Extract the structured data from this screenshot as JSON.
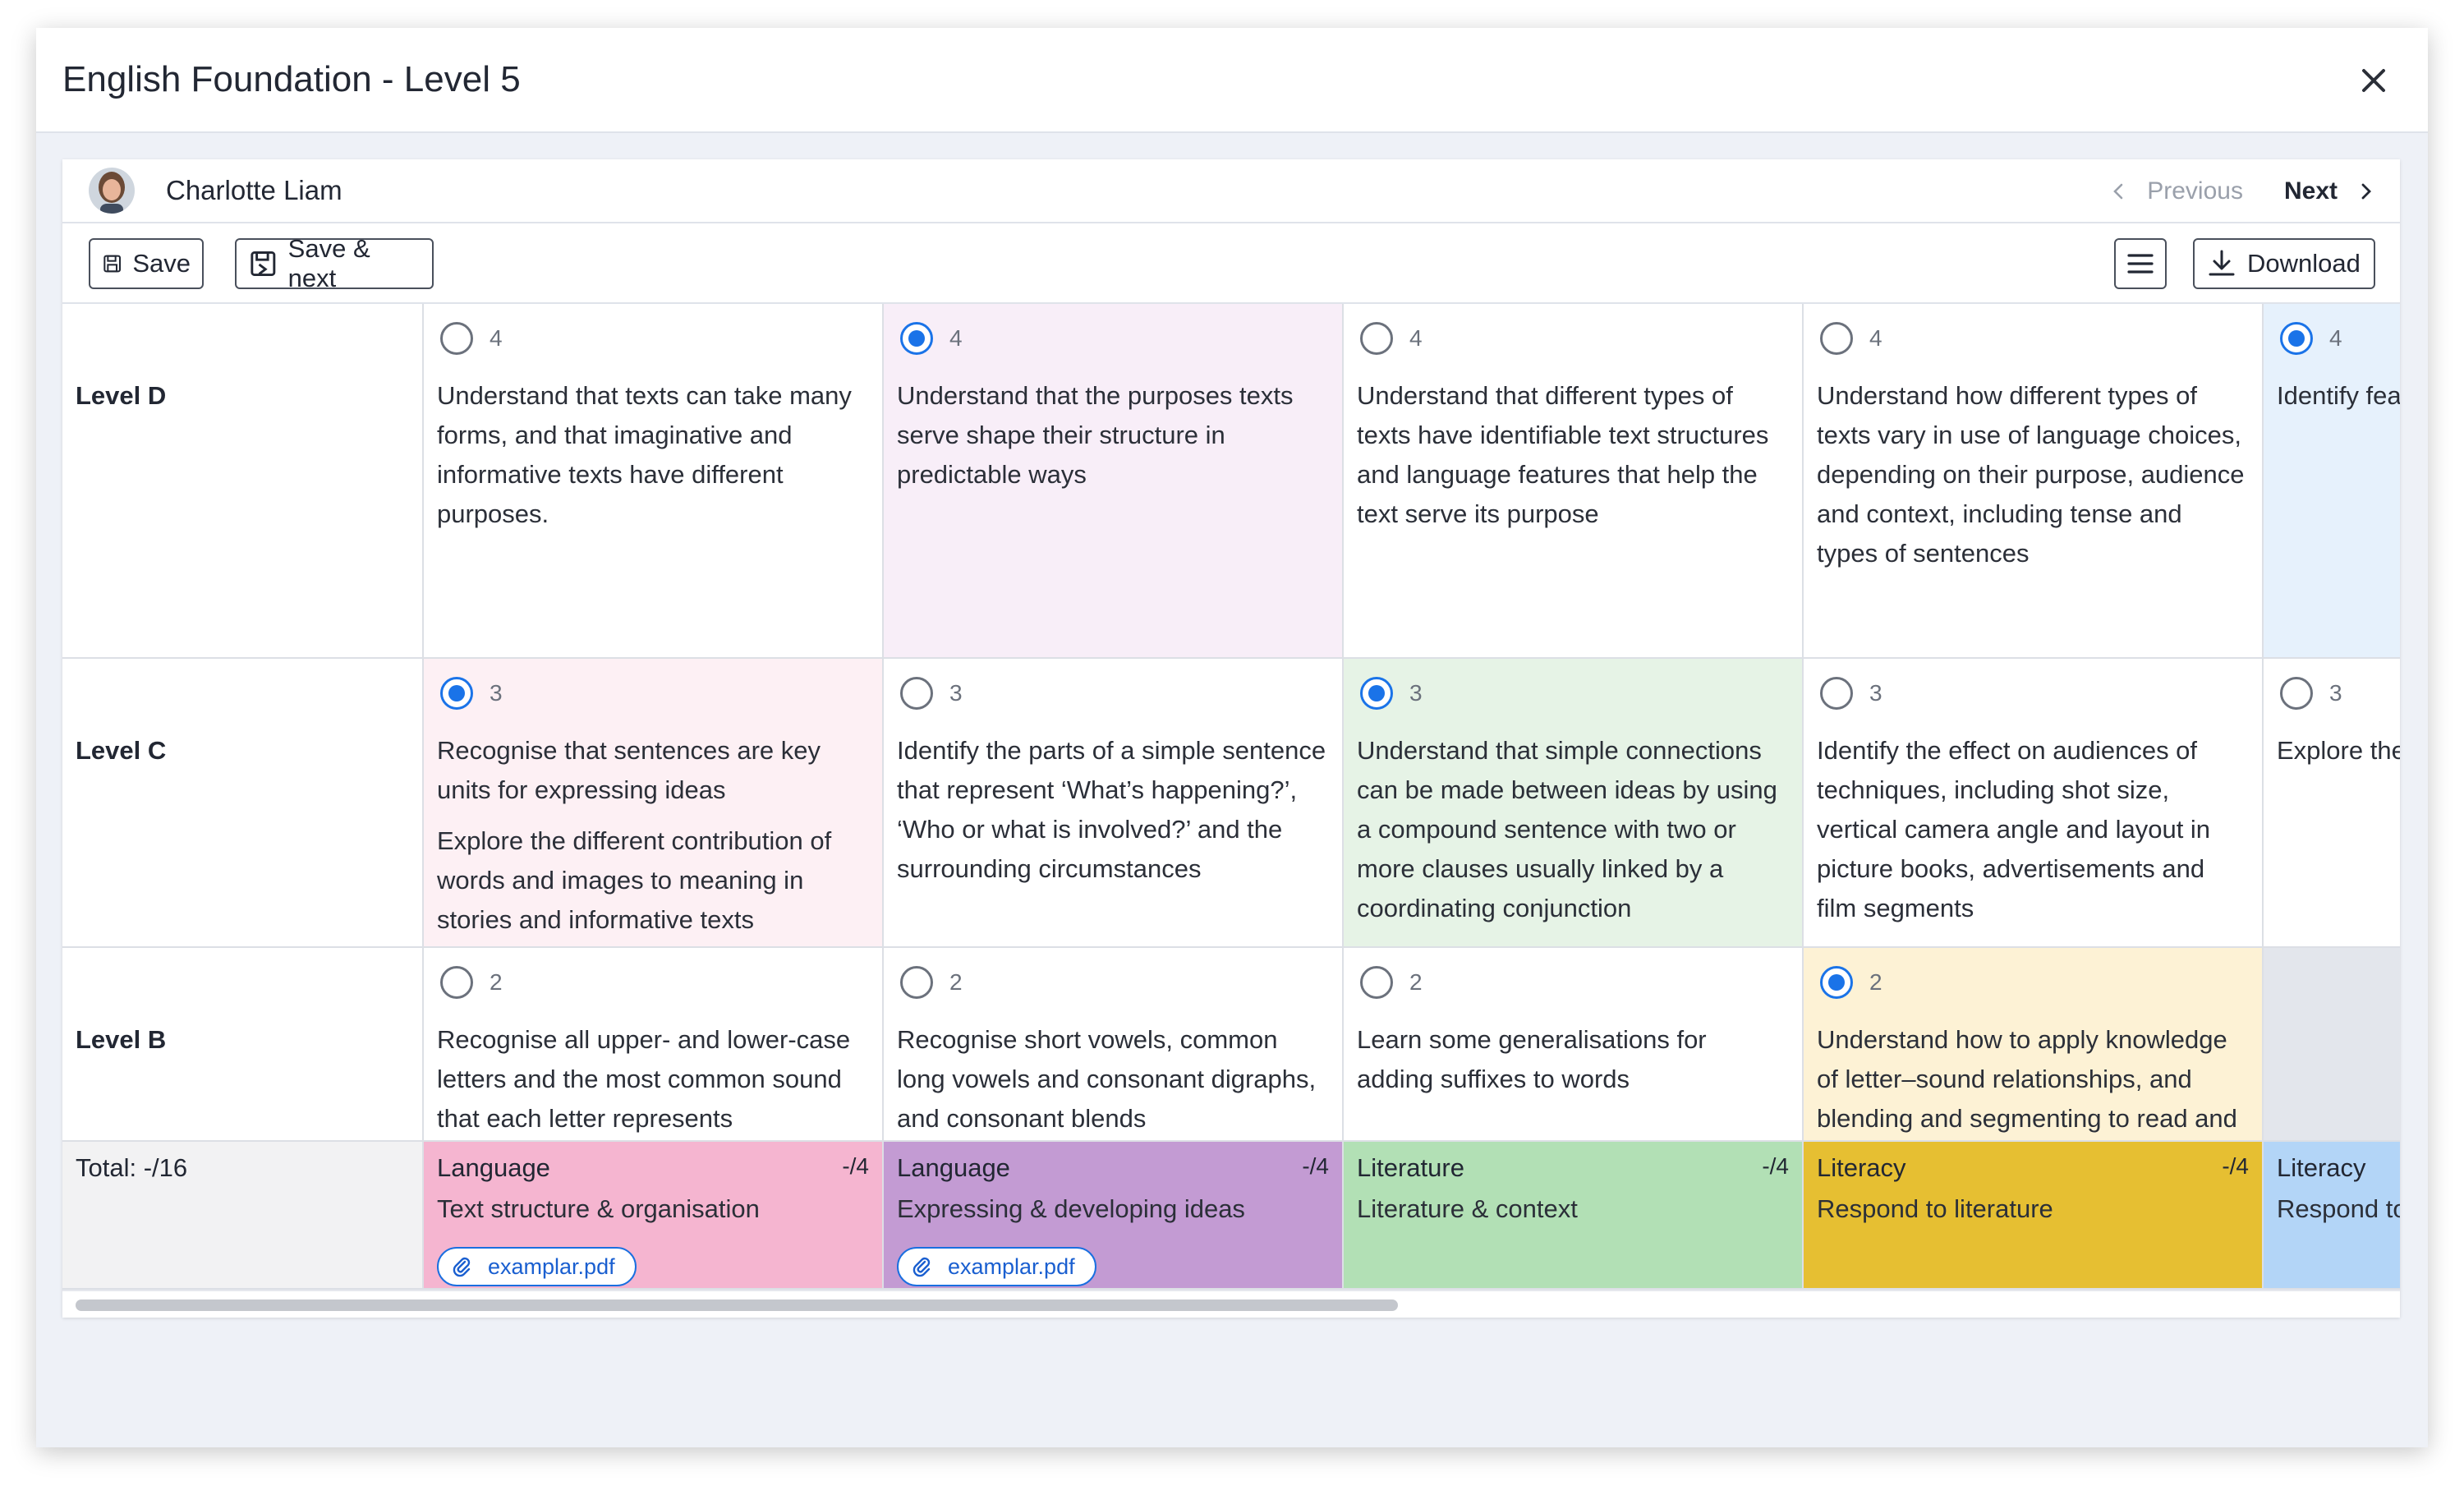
{
  "modal": {
    "title": "English Foundation - Level 5"
  },
  "student": {
    "name": "Charlotte Liam"
  },
  "pager": {
    "previous_label": "Previous",
    "next_label": "Next"
  },
  "toolbar": {
    "save_label": "Save",
    "save_next_label": "Save & next",
    "download_label": "Download"
  },
  "rubric": {
    "levels": [
      "Level D",
      "Level C",
      "Level B"
    ],
    "total_label": "Total: -/16",
    "rows": [
      {
        "score": "4",
        "cells": [
          {
            "selected": false,
            "desc": [
              "Understand that texts can take many forms, and that imaginative and informative texts have different purposes."
            ]
          },
          {
            "selected": true,
            "desc": [
              "Understand that the purposes texts serve shape their structure in predictable ways"
            ]
          },
          {
            "selected": false,
            "desc": [
              "Understand that different types of texts have identifiable text structures and language features that help the text serve its purpose"
            ]
          },
          {
            "selected": false,
            "desc": [
              "Understand how different types of texts vary in use of language choices, depending on their purpose, audience and context, including tense and types of sentences"
            ]
          },
          {
            "selected": true,
            "desc": [
              "Identify fea informative meet the pu understand complexity on the appr purpose an"
            ]
          }
        ]
      },
      {
        "score": "3",
        "cells": [
          {
            "selected": true,
            "desc": [
              "Recognise that sentences are key units for expressing ideas",
              "Explore the different contribution of words and images to meaning in stories and informative texts"
            ]
          },
          {
            "selected": false,
            "desc": [
              "Identify the parts of a simple sentence that represent ‘What’s happening?’, ‘Who or what is involved?’ and the surrounding circumstances"
            ]
          },
          {
            "selected": true,
            "desc": [
              "Understand that simple connections can be made between ideas by using a compound sentence with two or more clauses usually linked by a coordinating conjunction"
            ]
          },
          {
            "selected": false,
            "desc": [
              "Identify the effect on audiences of techniques, including shot size, vertical camera angle and layout in picture books, advertisements and film segments"
            ]
          },
          {
            "selected": false,
            "desc": [
              "Explore the framing an elements in compositio in a range o"
            ]
          }
        ]
      },
      {
        "score": "2",
        "cells": [
          {
            "selected": false,
            "desc": [
              "Recognise all upper- and lower-case letters and the most common sound that each letter represents"
            ]
          },
          {
            "selected": false,
            "desc": [
              "Recognise short vowels, common long vowels and consonant digraphs, and consonant blends"
            ]
          },
          {
            "selected": false,
            "desc": [
              "Learn some generalisations for adding suffixes to words"
            ]
          },
          {
            "selected": true,
            "desc": [
              "Understand how to apply knowledge of letter–sound relationships, and blending and segmenting to read and"
            ]
          },
          null
        ]
      }
    ],
    "strands": [
      {
        "name": "Language",
        "mark": "-/4",
        "sub": "Text structure & organisation",
        "attachment": "examplar.pdf"
      },
      {
        "name": "Language",
        "mark": "-/4",
        "sub": "Expressing & developing ideas",
        "attachment": "examplar.pdf"
      },
      {
        "name": "Literature",
        "mark": "-/4",
        "sub": "Literature & context",
        "attachment": null
      },
      {
        "name": "Literacy",
        "mark": "-/4",
        "sub": "Respond to literature",
        "attachment": null
      },
      {
        "name": "Literacy",
        "mark": "",
        "sub": "Respond to",
        "attachment": null
      }
    ]
  },
  "colors": {
    "accent": "#1a73e8",
    "strand_bg": [
      "#f5b5d0",
      "#c39bd3",
      "#b2e0b5",
      "#e6bf32",
      "#b3d5f7"
    ],
    "cell_selected_bg": [
      "#fdf0f4",
      "#f8eef8",
      "#e6f3e6",
      "#fdf2d5",
      "#e6f1fc"
    ],
    "empty_cell_bg": "#e3e6ec",
    "total_bg": "#f2f2f3"
  }
}
